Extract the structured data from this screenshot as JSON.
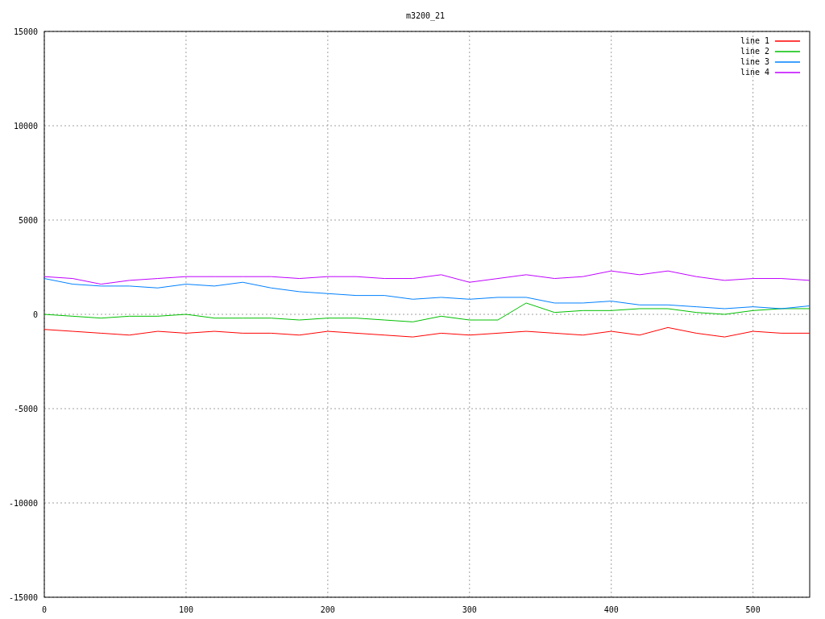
{
  "chart_data": {
    "type": "line",
    "title": "m3200_21",
    "x": [
      0,
      20,
      40,
      60,
      80,
      100,
      120,
      140,
      160,
      180,
      200,
      220,
      240,
      260,
      280,
      300,
      320,
      340,
      360,
      380,
      400,
      420,
      440,
      460,
      480,
      500,
      520,
      540
    ],
    "grid": true,
    "legend": true,
    "xlim": [
      0,
      540
    ],
    "ylim": [
      -15000,
      15000
    ],
    "xticks": [
      0,
      100,
      200,
      300,
      400,
      500
    ],
    "yticks": [
      -15000,
      -10000,
      -5000,
      0,
      5000,
      10000,
      15000
    ],
    "series": [
      {
        "name": "line 1",
        "color": "#ff0000",
        "values": [
          -800,
          -900,
          -1000,
          -1100,
          -900,
          -1000,
          -900,
          -1000,
          -1000,
          -1100,
          -900,
          -1000,
          -1100,
          -1200,
          -1000,
          -1100,
          -1000,
          -900,
          -1000,
          -1100,
          -900,
          -1100,
          -700,
          -1000,
          -1200,
          -900,
          -1000,
          -1000
        ]
      },
      {
        "name": "line 2",
        "color": "#00c000",
        "values": [
          0,
          -100,
          -200,
          -100,
          -100,
          0,
          -200,
          -200,
          -200,
          -300,
          -200,
          -200,
          -300,
          -400,
          -100,
          -300,
          -300,
          600,
          100,
          200,
          200,
          300,
          300,
          100,
          0,
          200,
          300,
          300
        ]
      },
      {
        "name": "line 3",
        "color": "#0080ff",
        "values": [
          1900,
          1600,
          1500,
          1500,
          1400,
          1600,
          1500,
          1700,
          1400,
          1200,
          1100,
          1000,
          1000,
          800,
          900,
          800,
          900,
          900,
          600,
          600,
          700,
          500,
          500,
          400,
          300,
          400,
          300,
          450
        ]
      },
      {
        "name": "line 4",
        "color": "#c000ff",
        "values": [
          2000,
          1900,
          1600,
          1800,
          1900,
          2000,
          2000,
          2000,
          2000,
          1900,
          2000,
          2000,
          1900,
          1900,
          2100,
          1700,
          1900,
          2100,
          1900,
          2000,
          2300,
          2100,
          2300,
          2000,
          1800,
          1900,
          1900,
          1800
        ]
      }
    ]
  }
}
